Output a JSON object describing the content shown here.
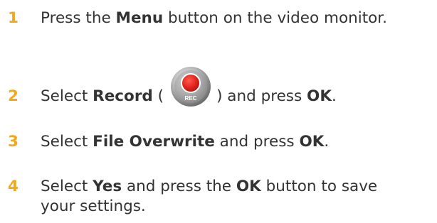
{
  "steps": [
    {
      "number": "1",
      "before": "Press the ",
      "bold1": "Menu",
      "after": " button on the video monitor."
    },
    {
      "number": "2",
      "before": "Select ",
      "bold1": "Record",
      "paren_open": " (",
      "icon": "record-icon",
      "icon_label": "REC",
      "paren_close": ") and press ",
      "bold2": "OK",
      "end": "."
    },
    {
      "number": "3",
      "before": "Select ",
      "bold1": "File Overwrite",
      "middle": " and press ",
      "bold2": "OK",
      "end": "."
    },
    {
      "number": "4",
      "before": "Select ",
      "bold1": "Yes",
      "middle": " and press the ",
      "bold2": "OK",
      "after_line1": " button to save",
      "line2": "your settings."
    }
  ],
  "colors": {
    "step_number": "#f0a81c",
    "text": "#333333",
    "rec_red": "#e0211b"
  }
}
